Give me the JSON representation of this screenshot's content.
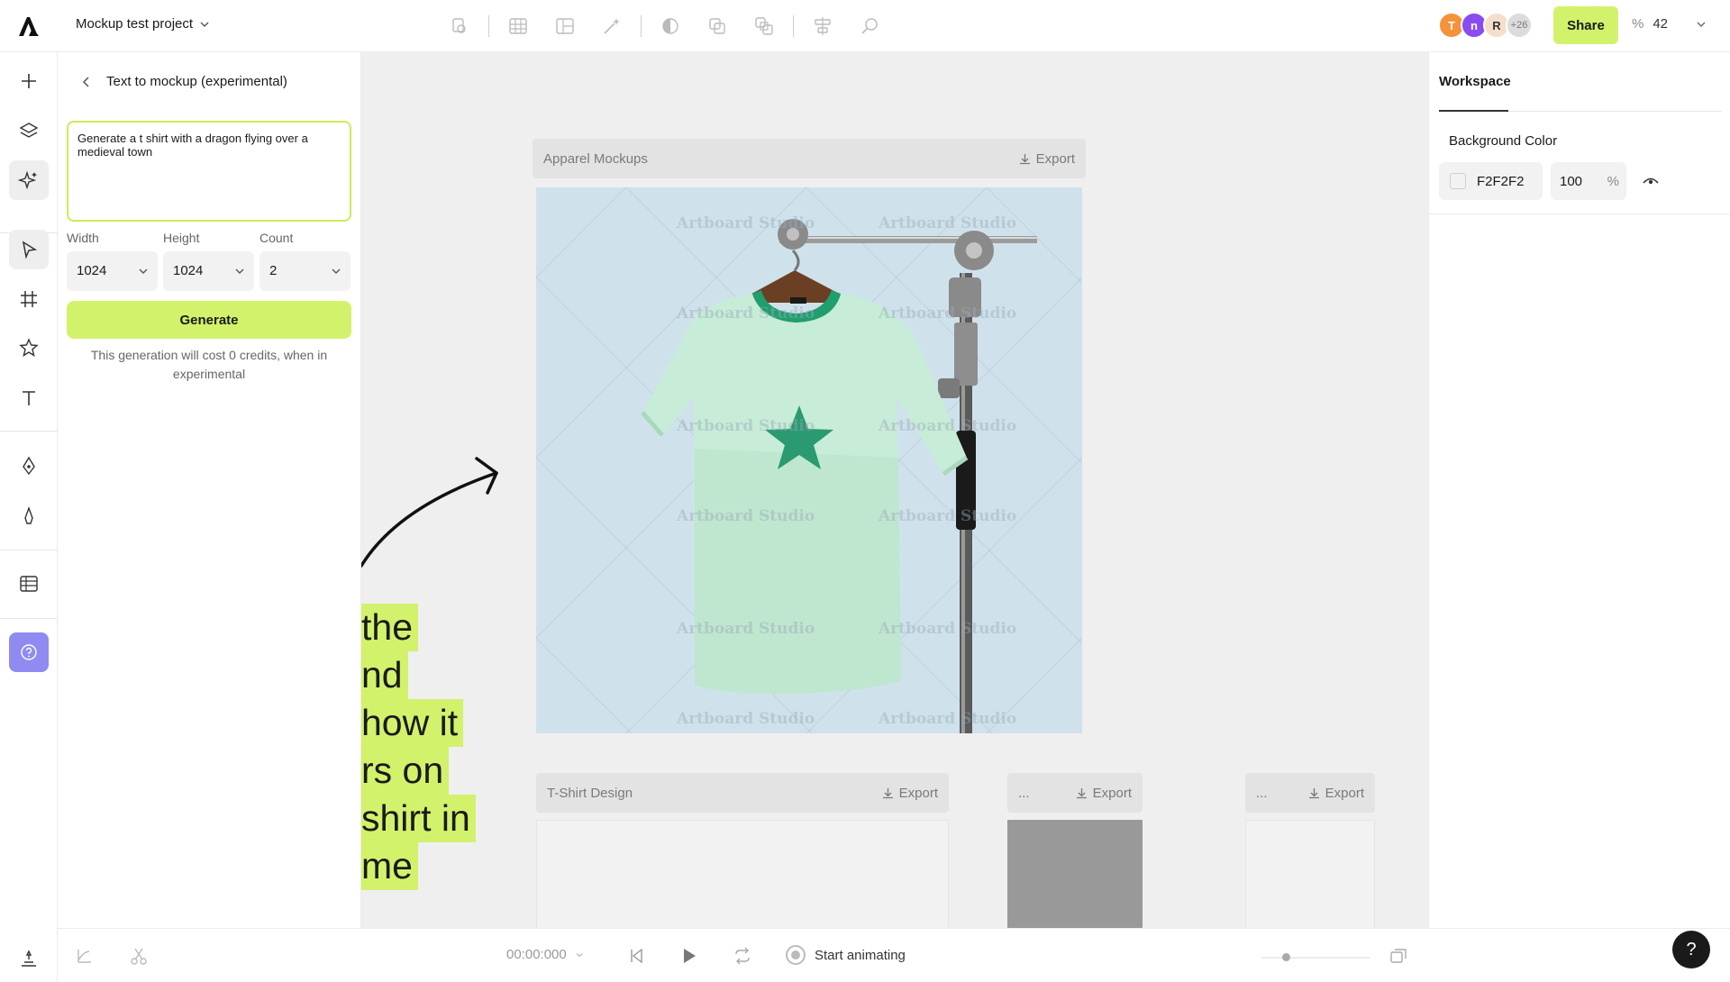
{
  "header": {
    "project_name": "Mockup test project",
    "share_label": "Share",
    "zoom_unit": "%",
    "zoom_value": "42",
    "collaborators": [
      {
        "initial": "T",
        "color": "#f4933a"
      },
      {
        "initial": "n",
        "color": "#8a4bf0"
      },
      {
        "initial": "R",
        "color": "#f6dfca"
      }
    ],
    "collaborators_more": "+26",
    "toolbar_icons": [
      "boolean-icon",
      "table-grid-icon",
      "layout-grid-icon",
      "magic-wand-icon",
      "mask-icon",
      "duplicate-icon",
      "flatten-icon",
      "align-icon",
      "search-replace-icon"
    ]
  },
  "rail": {
    "icons": [
      "add-icon",
      "layers-icon",
      "ai-sparkle-icon",
      "select-pointer-icon",
      "frame-icon",
      "star-shape-icon",
      "text-tool-icon",
      "pen-icon",
      "pencil-icon",
      "table-icon",
      "help-icon",
      "layers-bottom-icon"
    ]
  },
  "panel": {
    "title": "Text to mockup (experimental)",
    "prompt_value": "Generate a t shirt with a dragon flying over a medieval town",
    "width_label": "Width",
    "height_label": "Height",
    "count_label": "Count",
    "width_value": "1024",
    "height_value": "1024",
    "count_value": "2",
    "generate_label": "Generate",
    "note": "This generation will cost 0 credits, when in experimental"
  },
  "canvas": {
    "boards": [
      {
        "name": "Apparel Mockups",
        "export": "Export"
      },
      {
        "name": "T-Shirt Design",
        "export": "Export"
      },
      {
        "name": "...",
        "export": "Export"
      },
      {
        "name": "...",
        "export": "Export"
      }
    ],
    "watermark": "Artboard Studio",
    "overlay_lines": [
      "the",
      "nd",
      "how it",
      "rs on",
      "shirt in",
      "me"
    ]
  },
  "props": {
    "tab": "Workspace",
    "bg_title": "Background Color",
    "bg_hex": "F2F2F2",
    "bg_opacity": "100",
    "bg_opacity_unit": "%"
  },
  "bottombar": {
    "timecode": "00:00:000",
    "start_animating": "Start animating"
  },
  "help_fab": "?"
}
